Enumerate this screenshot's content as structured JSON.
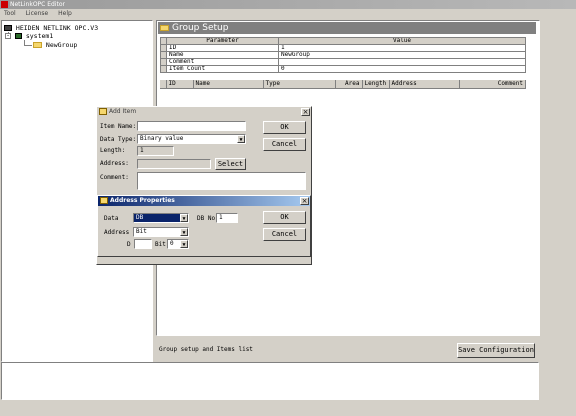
{
  "window": {
    "title": "NetLinkOPC Editor"
  },
  "menu": [
    {
      "label": "Tool"
    },
    {
      "label": "License"
    },
    {
      "label": "Help"
    }
  ],
  "tree": {
    "root": "HEIDEN NETLINK OPC.V3",
    "child": "system1",
    "group": "NewGroup"
  },
  "group_setup": {
    "title": "Group Setup",
    "param_headers": {
      "parameter": "Parameter",
      "value": "Value"
    },
    "params": [
      {
        "name": "ID",
        "value": "1"
      },
      {
        "name": "Name",
        "value": "NewGroup"
      },
      {
        "name": "Comment",
        "value": ""
      },
      {
        "name": "Item Count",
        "value": "0"
      }
    ],
    "item_columns": [
      "ID",
      "Name",
      "Type",
      "Area",
      "Length",
      "Address",
      "Comment"
    ],
    "status_text": "Group setup and Items list",
    "save_label": "Save Configuration"
  },
  "add_item": {
    "title": "Add Item",
    "item_name_label": "Item Name:",
    "item_name_value": "",
    "data_type_label": "Data Type:",
    "data_type_value": "Binary value",
    "length_label": "Length:",
    "length_value": "1",
    "address_label": "Address:",
    "address_value": "",
    "select_label": "Select",
    "comment_label": "Comment:",
    "comment_value": "",
    "ok_label": "OK",
    "cancel_label": "Cancel"
  },
  "address_props": {
    "title": "Address Properties",
    "data_label": "Data",
    "data_value": "DB",
    "dbno_label": "DB No.",
    "dbno_value": "1",
    "address_label": "Address",
    "address_value": "Bit",
    "d_label": "D",
    "d_value": "",
    "bit_label": "Bit",
    "bit_value": "0",
    "ok_label": "OK",
    "cancel_label": "Cancel"
  }
}
